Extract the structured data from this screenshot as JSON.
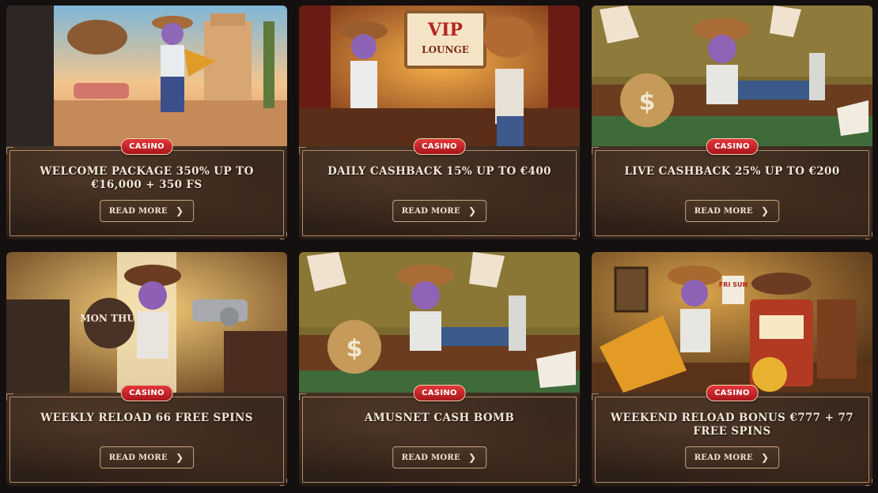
{
  "promotions": [
    {
      "badge": "CASINO",
      "title": "WELCOME PACKAGE 350% UP TO €16,000 + 350 FS",
      "button": "READ MORE",
      "scene": "street"
    },
    {
      "badge": "CASINO",
      "title": "DAILY CASHBACK 15% UP TO €400",
      "button": "READ MORE",
      "scene": "vip-lounge",
      "sign": "VIP",
      "sign2": "LOUNGE"
    },
    {
      "badge": "CASINO",
      "title": "LIVE CASHBACK 25% UP TO €200",
      "button": "READ MORE",
      "scene": "card-table"
    },
    {
      "badge": "CASINO",
      "title": "WEEKLY RELOAD 66 FREE SPINS",
      "button": "READ MORE",
      "scene": "saloon-door",
      "bag_text": "MON THU"
    },
    {
      "badge": "CASINO",
      "title": "AMUSNET CASH BOMB",
      "button": "READ MORE",
      "scene": "card-table"
    },
    {
      "badge": "CASINO",
      "title": "WEEKEND RELOAD BONUS €777 + 77 FREE SPINS",
      "button": "READ MORE",
      "scene": "slot-machine",
      "sign": "FRI SUN"
    }
  ],
  "icons": {
    "button_chevron": "chevron-right-icon"
  },
  "colors": {
    "badge": "#c8202a",
    "button_border": "#c7a37f",
    "panel": "#33241a",
    "text": "#f3e6d6"
  }
}
